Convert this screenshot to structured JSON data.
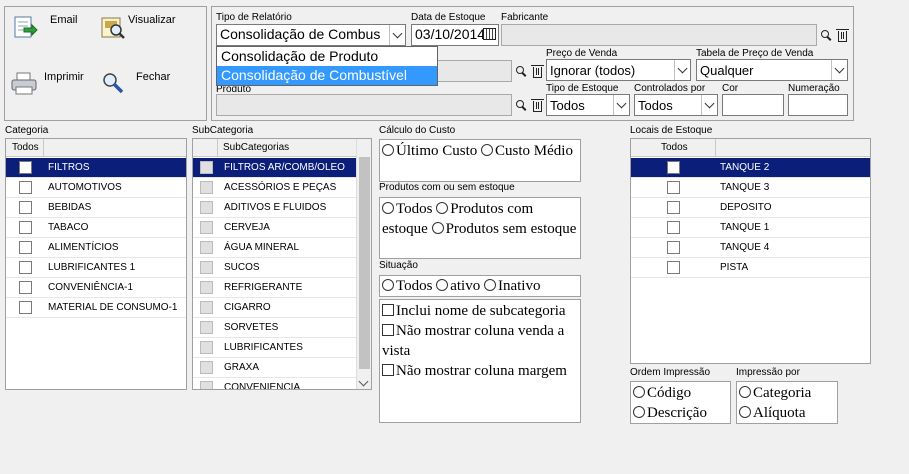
{
  "toolbar": {
    "email": "Email",
    "visualizar": "Visualizar",
    "imprimir": "Imprimir",
    "fechar": "Fechar"
  },
  "filters": {
    "tipo_relatorio_label": "Tipo de Relatório",
    "tipo_relatorio_value": "Consolidação de Combus",
    "tipo_relatorio_options": [
      "Consolidação de Produto",
      "Consolidação de Combustível"
    ],
    "data_estoque_label": "Data de Estoque",
    "data_estoque_value": "03/10/2014",
    "fabricante_label": "Fabricante",
    "preco_venda_label": "Preço de Venda",
    "preco_venda_value": "Ignorar (todos)",
    "tabela_preco_label": "Tabela de Preço de Venda",
    "tabela_preco_value": "Qualquer",
    "produto_label": "Produto",
    "tipo_estoque_label": "Tipo de Estoque",
    "tipo_estoque_value": "Todos",
    "controlados_label": "Controlados por",
    "controlados_value": "Todos",
    "cor_label": "Cor",
    "numeracao_label": "Numeração"
  },
  "categoria": {
    "title": "Categoria",
    "header": "Todos",
    "items": [
      "FILTROS",
      "AUTOMOTIVOS",
      "BEBIDAS",
      "TABACO",
      "ALIMENTÍCIOS",
      "LUBRIFICANTES 1",
      "CONVENIÊNCIA-1",
      "MATERIAL DE CONSUMO-1"
    ]
  },
  "subcategoria": {
    "title": "SubCategoria",
    "header": "SubCategorias",
    "items": [
      "FILTROS AR/COMB/OLEO",
      "ACESSÓRIOS E PEÇAS",
      "ADITIVOS E FLUIDOS",
      "CERVEJA",
      "ÁGUA MINERAL",
      "SUCOS",
      "REFRIGERANTE",
      "CIGARRO",
      "SORVETES",
      "LUBRIFICANTES",
      "GRAXA",
      "CONVENIENCIA"
    ]
  },
  "calculo": {
    "title": "Cálculo do Custo",
    "opt1": "Último Custo",
    "opt2": "Custo Médio"
  },
  "produtos_estoque": {
    "title": "Produtos com ou sem estoque",
    "opt1": "Todos",
    "opt2": "Produtos com estoque",
    "opt3": "Produtos sem estoque"
  },
  "situacao": {
    "title": "Situação",
    "opt1": "Todos",
    "opt2": "ativo",
    "opt3": "Inativo"
  },
  "opcoes": {
    "chk1": "Inclui nome de subcategoria",
    "chk2": "Não mostrar coluna venda a vista",
    "chk3": "Não mostrar coluna margem"
  },
  "locais": {
    "title": "Locais de Estoque",
    "header": "Todos",
    "items": [
      "TANQUE 2",
      "TANQUE 3",
      "DEPOSITO",
      "TANQUE 1",
      "TANQUE 4",
      "PISTA"
    ]
  },
  "ordem": {
    "title": "Ordem Impressão",
    "opt1": "Código",
    "opt2": "Descrição"
  },
  "impressao": {
    "title": "Impressão por",
    "opt1": "Categoria",
    "opt2": "Alíquota"
  },
  "colors": {
    "selection": "#0b1f7a",
    "dropdown_highlight": "#3399ff"
  }
}
